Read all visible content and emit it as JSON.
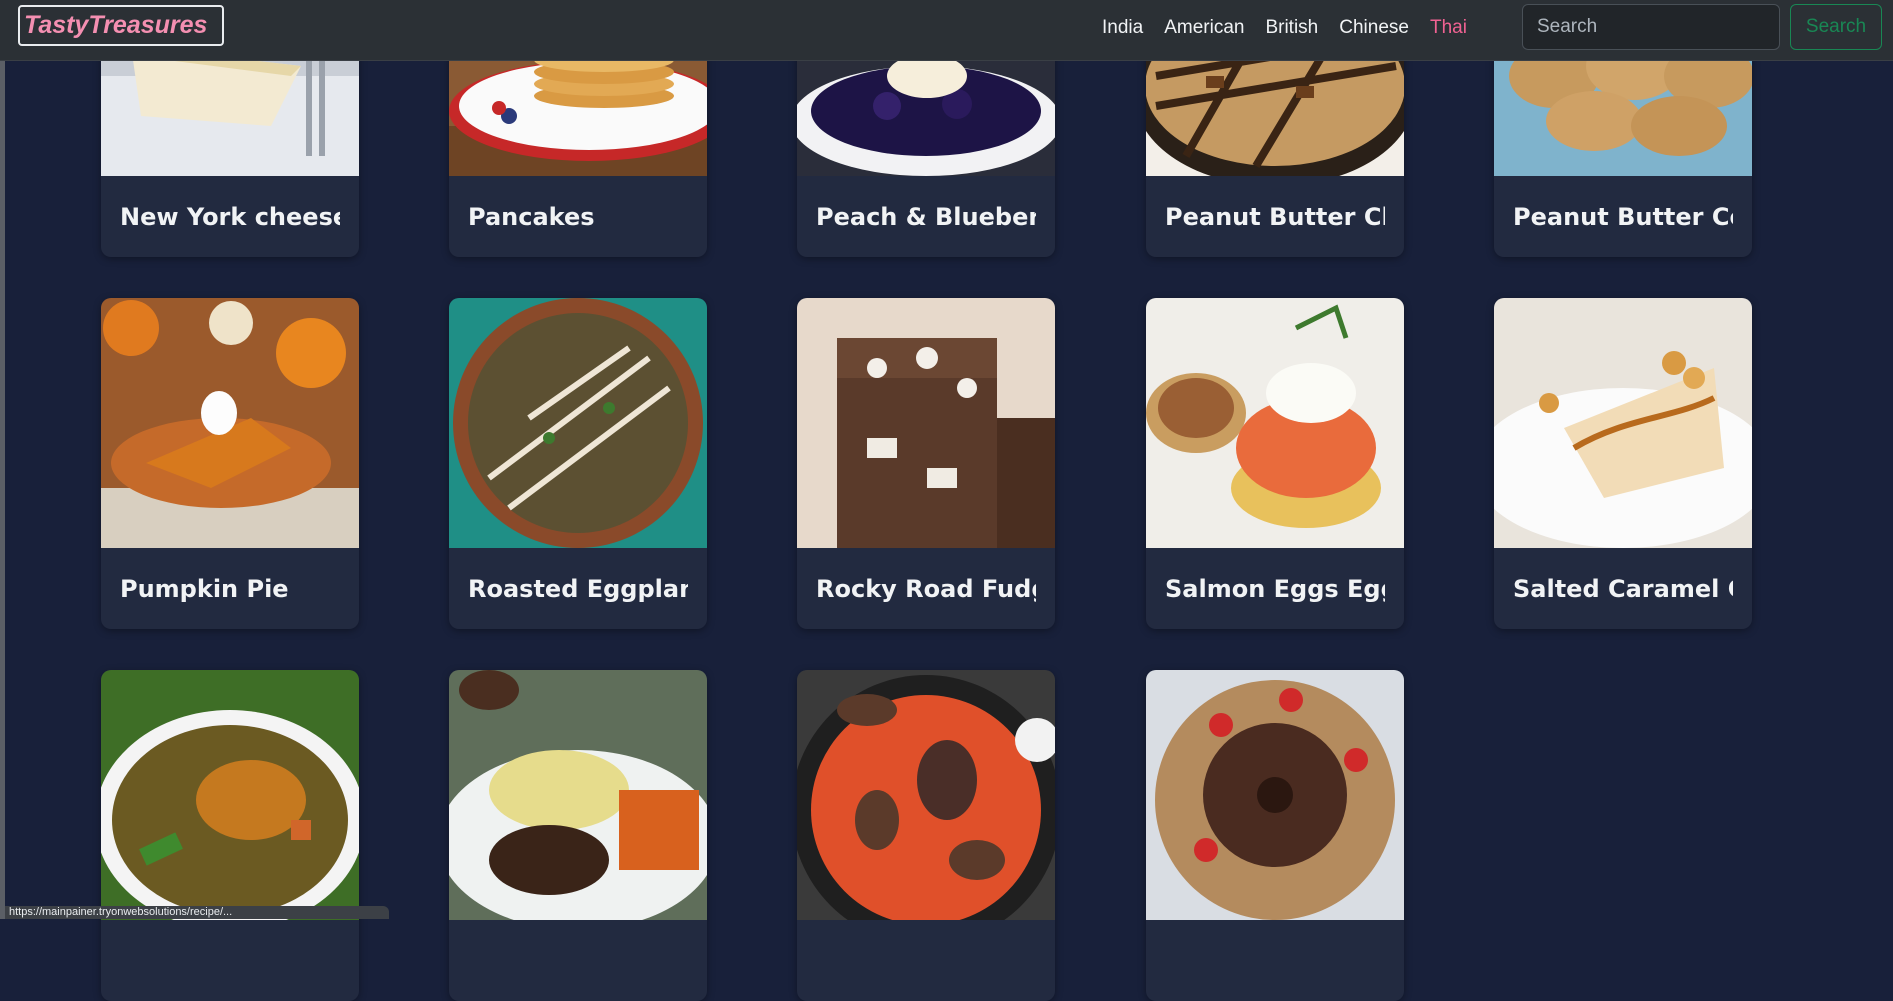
{
  "navbar": {
    "brand": "TastyTreasures",
    "links": [
      "India",
      "American",
      "British",
      "Chinese",
      "Thai"
    ],
    "active_link": "Thai",
    "search_placeholder": "Search",
    "search_button": "Search"
  },
  "recipes": [
    {
      "title": "New York cheesec"
    },
    {
      "title": "Pancakes"
    },
    {
      "title": "Peach & Blueberr"
    },
    {
      "title": "Peanut Butter Ch"
    },
    {
      "title": "Peanut Butter Co"
    },
    {
      "title": "Pumpkin Pie"
    },
    {
      "title": "Roasted Eggplant"
    },
    {
      "title": "Rocky Road Fudge"
    },
    {
      "title": "Salmon Eggs Eggs"
    },
    {
      "title": "Salted Caramel C"
    },
    {
      "title": ""
    },
    {
      "title": ""
    },
    {
      "title": ""
    },
    {
      "title": ""
    }
  ],
  "colors": {
    "page_bg": "#18203a",
    "navbar_bg": "#2b3035",
    "brand_text": "#f48fb1",
    "active_link": "#f06292",
    "search_button": "#198754",
    "card_bg": "#222a40"
  },
  "status_bar": {
    "url": "https://mainpainer.tryonwebsolutions/recipe/..."
  }
}
